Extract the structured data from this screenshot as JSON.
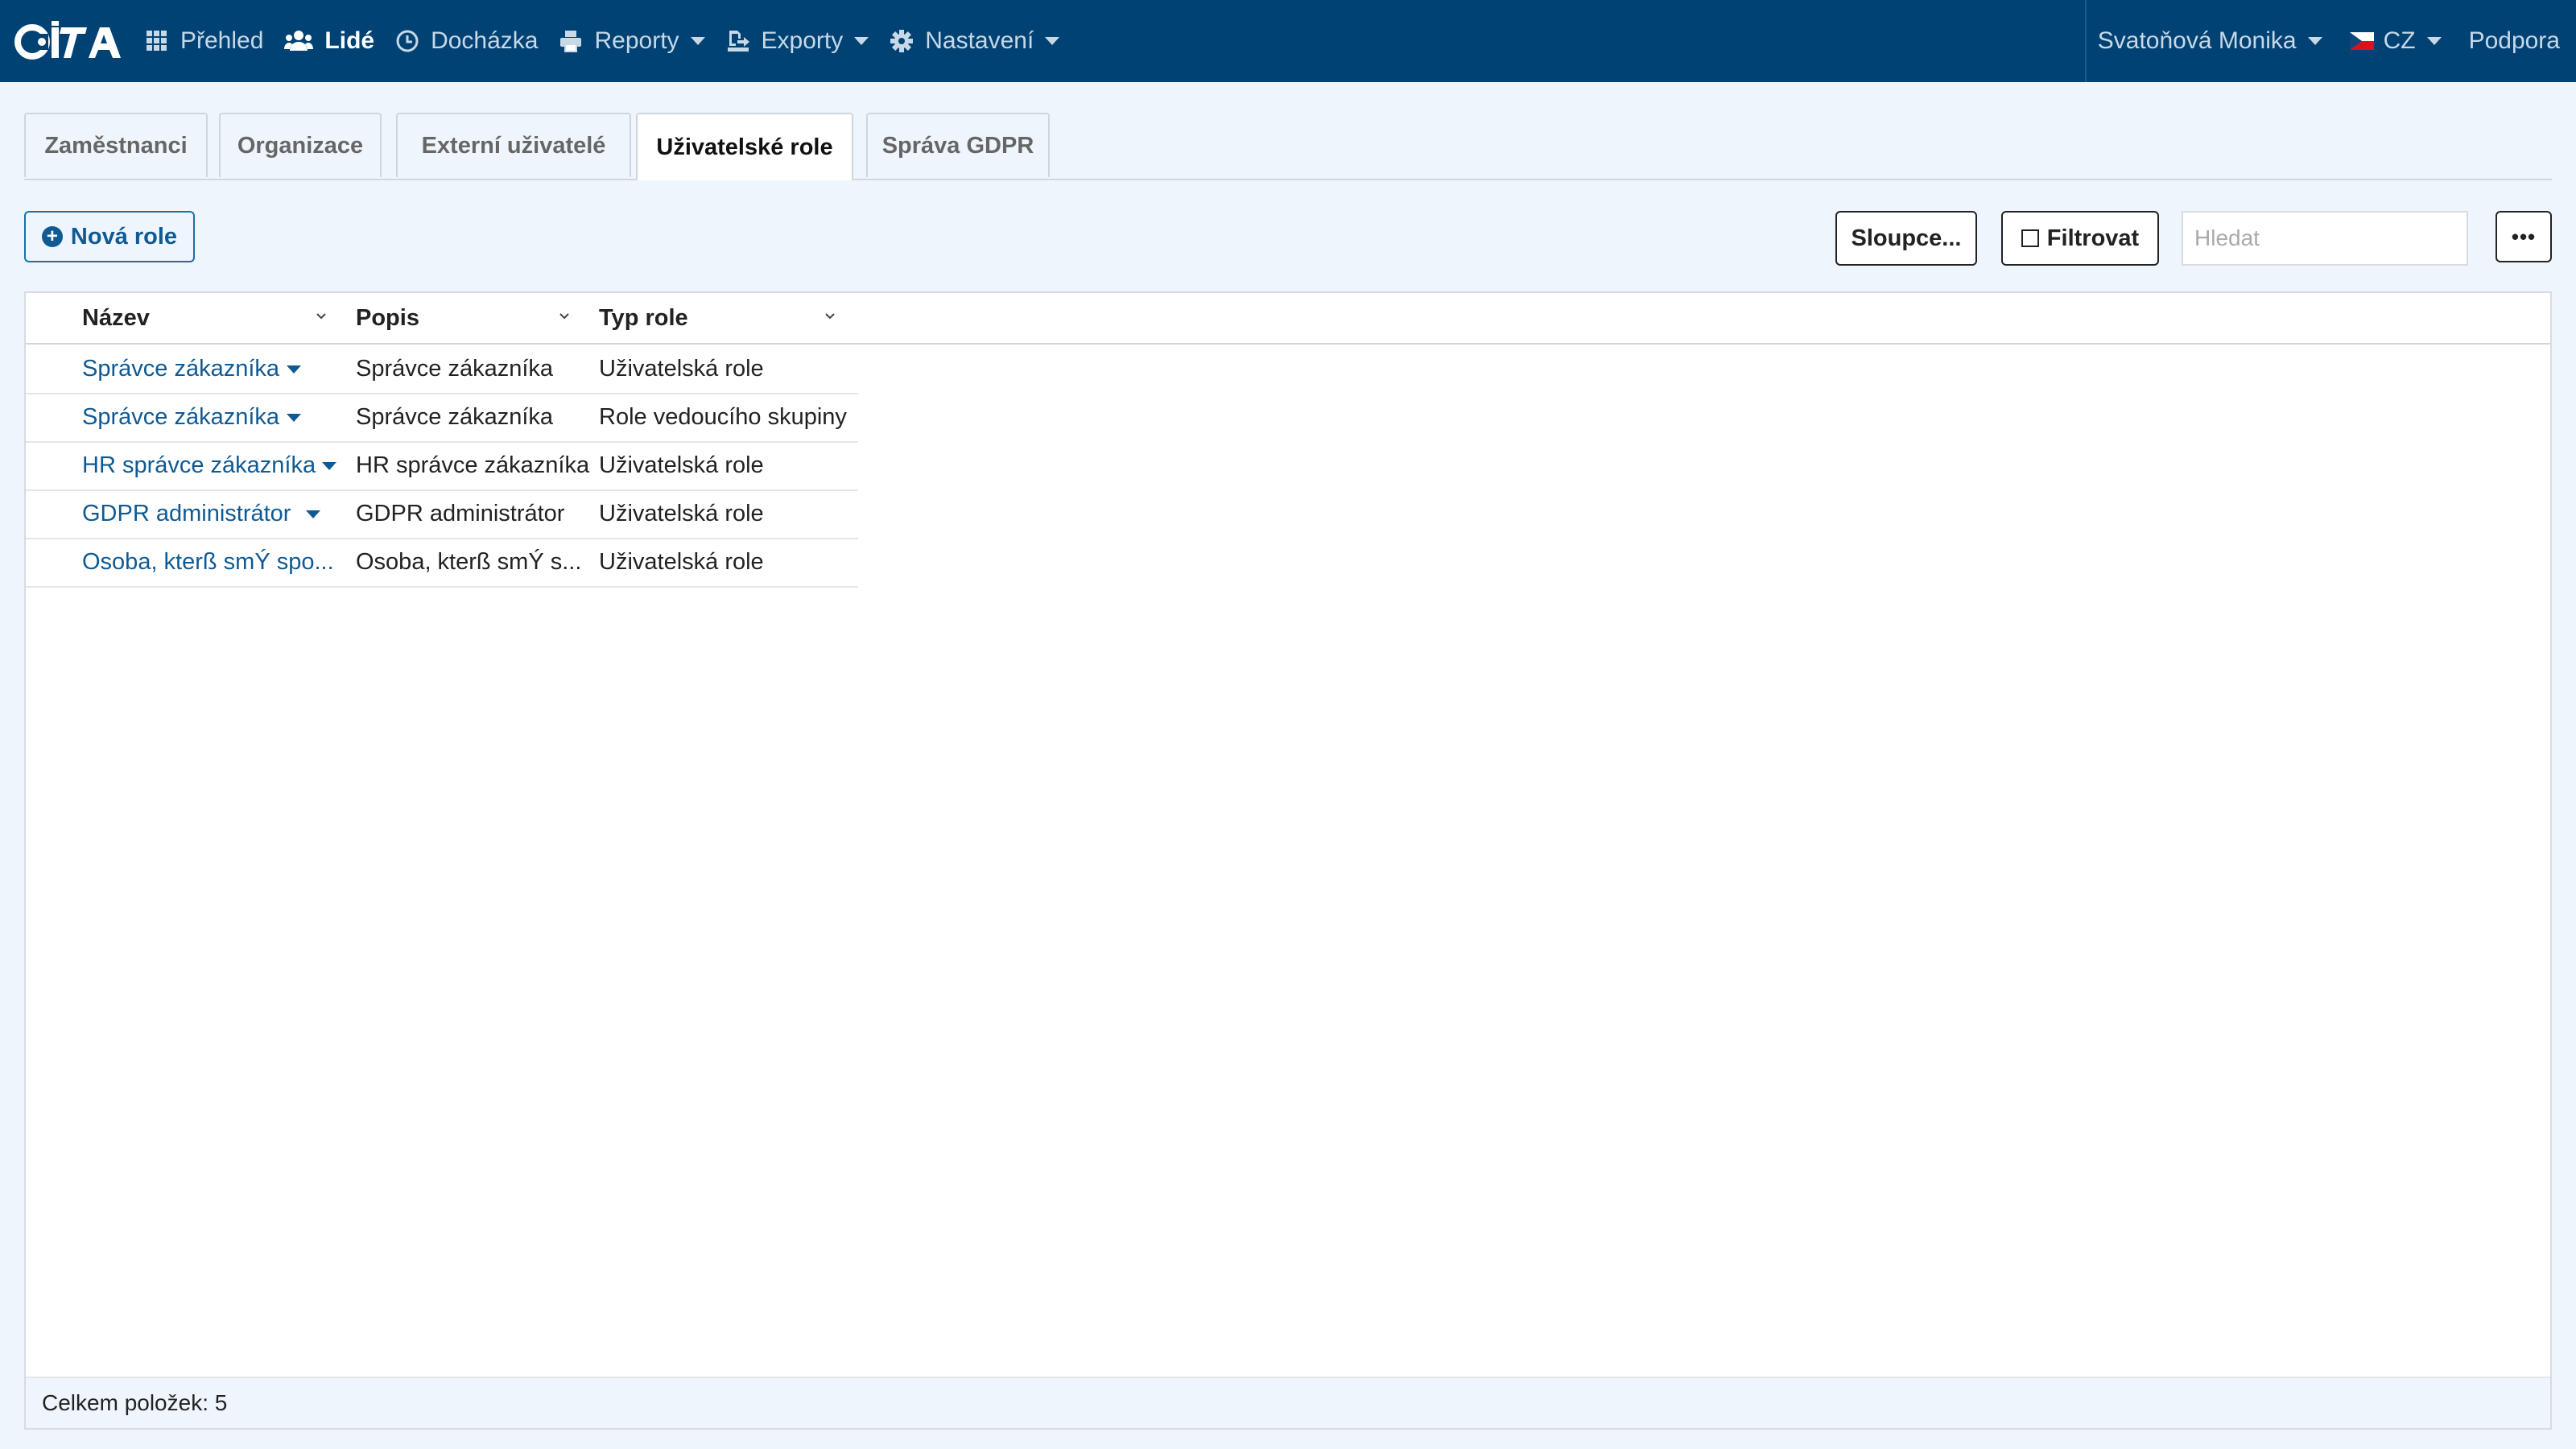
{
  "app": {
    "logo_text": "CiTA",
    "brand_color": "#004273",
    "link_color": "#0f5a93"
  },
  "nav": {
    "items": [
      {
        "label": "Přehled",
        "icon": "grid-icon"
      },
      {
        "label": "Lidé",
        "icon": "users-icon",
        "active": true
      },
      {
        "label": "Docházka",
        "icon": "clock-icon"
      },
      {
        "label": "Reporty",
        "icon": "printer-icon",
        "dropdown": true
      },
      {
        "label": "Exporty",
        "icon": "export-icon",
        "dropdown": true
      },
      {
        "label": "Nastavení",
        "icon": "gear-icon",
        "dropdown": true
      }
    ],
    "user": "Svatoňová Monika",
    "language": "CZ",
    "support": "Podpora"
  },
  "tabs": [
    "Zaměstnanci",
    "Organizace",
    "Externí uživatelé",
    "Uživatelské role",
    "Správa GDPR"
  ],
  "active_tab": "Uživatelské role",
  "toolbar": {
    "new_role": "Nová role",
    "columns": "Sloupce...",
    "filter": "Filtrovat",
    "search_placeholder": "Hledat",
    "more": "•••"
  },
  "table": {
    "columns": [
      "Název",
      "Popis",
      "Typ role"
    ],
    "rows": [
      {
        "name": "Správce zákazníka",
        "description": "Správce zákazníka",
        "type": "Uživatelská role"
      },
      {
        "name": "Správce zákazníka",
        "description": "Správce zákazníka",
        "type": "Role vedoucího skupiny"
      },
      {
        "name": "HR správce zákazníka",
        "description": "HR správce zákazníka",
        "type": "Uživatelská role"
      },
      {
        "name": "GDPR administrátor",
        "description": "GDPR administrátor",
        "type": "Uživatelská role"
      },
      {
        "name": "Osoba, kterß smÝ spo...",
        "description": "Osoba, kterß smÝ s...",
        "type": "Uživatelská role"
      }
    ],
    "footer": "Celkem položek: 5"
  }
}
